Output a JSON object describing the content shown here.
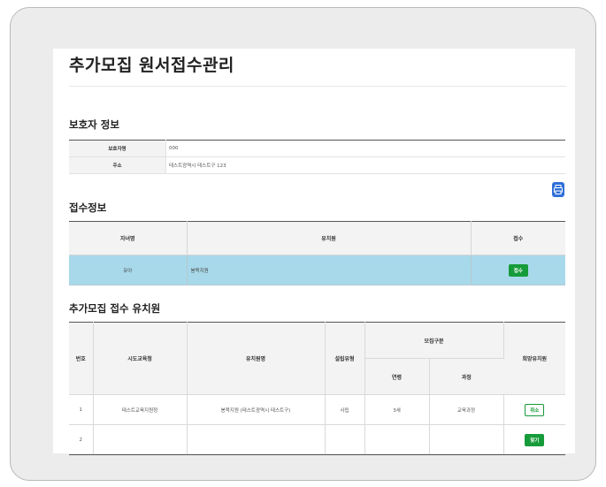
{
  "page_title": "추가모집 원서접수관리",
  "guardian_section": {
    "heading": "보호자 정보",
    "rows": [
      {
        "label": "보호자명",
        "value": "000"
      },
      {
        "label": "주소",
        "value": "테스트광역시 테스트구 123"
      }
    ]
  },
  "reception_section": {
    "heading": "접수정보",
    "print_icon": "printer-icon",
    "headers": [
      "자녀명",
      "유치원",
      "접수"
    ],
    "row": {
      "child": "유아",
      "kindergarten": "봉묵지원",
      "action_label": "접수"
    }
  },
  "extra_section": {
    "heading": "추가모집 접수 유치원",
    "headers": {
      "no": "번호",
      "office": "시도교육청",
      "kindergarten": "유치원명",
      "type": "설립유형",
      "group": "모집구분",
      "age": "연령",
      "course": "과정",
      "wish": "희망유치원"
    },
    "rows": [
      {
        "no": "1",
        "office": "테스트교육지원청",
        "kindergarten": "봉묵지원 (테스트광역시 테스트구)",
        "type": "사립",
        "age": "3세",
        "course": "교육과정",
        "action_label": "취소"
      },
      {
        "no": "2",
        "office": "",
        "kindergarten": "",
        "type": "",
        "age": "",
        "course": "",
        "action_label": "찾기"
      }
    ]
  },
  "colors": {
    "accent_green": "#169b3a",
    "selected_row": "#a8d9ea",
    "print_button": "#2f6fd8"
  }
}
